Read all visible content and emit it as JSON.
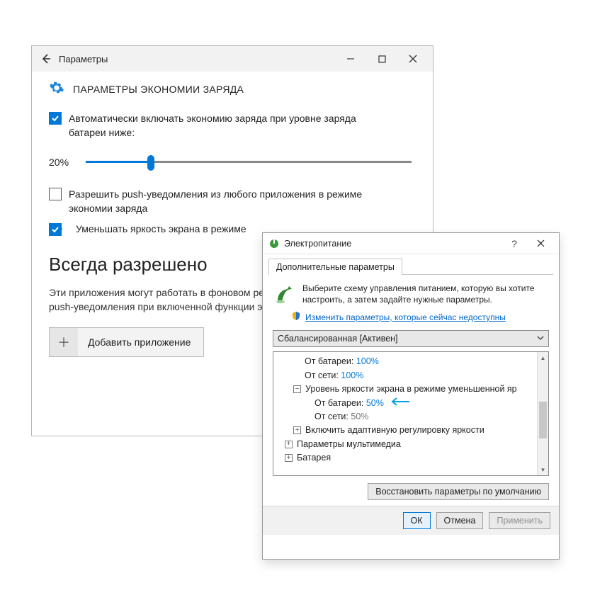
{
  "settings": {
    "titlebar": {
      "title": "Параметры"
    },
    "page_title": "ПАРАМЕТРЫ ЭКОНОМИИ ЗАРЯДА",
    "auto_enable": {
      "checked": true,
      "label": "Автоматически включать экономию заряда при уровне заряда батареи ниже:"
    },
    "threshold": {
      "value_text": "20%",
      "percent": 20
    },
    "push": {
      "checked": false,
      "label": "Разрешить push-уведомления из любого приложения в режиме экономии заряда"
    },
    "brightness": {
      "checked": true,
      "label": "Уменьшать яркость экрана в режиме"
    },
    "always": {
      "title": "Всегда разрешено",
      "desc": "Эти приложения могут работать в фоновом режиме, отправлять и принимать push-уведомления при включенной функции экономии заряда.",
      "add_btn": "Добавить приложение"
    }
  },
  "power": {
    "title": "Электропитание",
    "tab": "Дополнительные параметры",
    "hint": "Выберите схему управления питанием, которую вы хотите настроить, а затем задайте нужные параметры.",
    "link": "Изменить параметры, которые сейчас недоступны",
    "scheme": "Сбалансированная [Активен]",
    "tree": {
      "r1": {
        "label": "От батареи:",
        "value": "100%"
      },
      "r2": {
        "label": "От сети:",
        "value": "100%"
      },
      "r3": {
        "label": "Уровень яркости экрана в режиме уменьшенной яр"
      },
      "r4": {
        "label": "От батареи:",
        "value": "50%"
      },
      "r5": {
        "label": "От сети:",
        "value": "50%"
      },
      "r6": {
        "label": "Включить адаптивную регулировку яркости"
      },
      "r7": {
        "label": "Параметры мультимедиа"
      },
      "r8": {
        "label": "Батарея"
      }
    },
    "restore": "Восстановить параметры по умолчанию",
    "ok": "ОК",
    "cancel": "Отмена",
    "apply": "Применить"
  }
}
